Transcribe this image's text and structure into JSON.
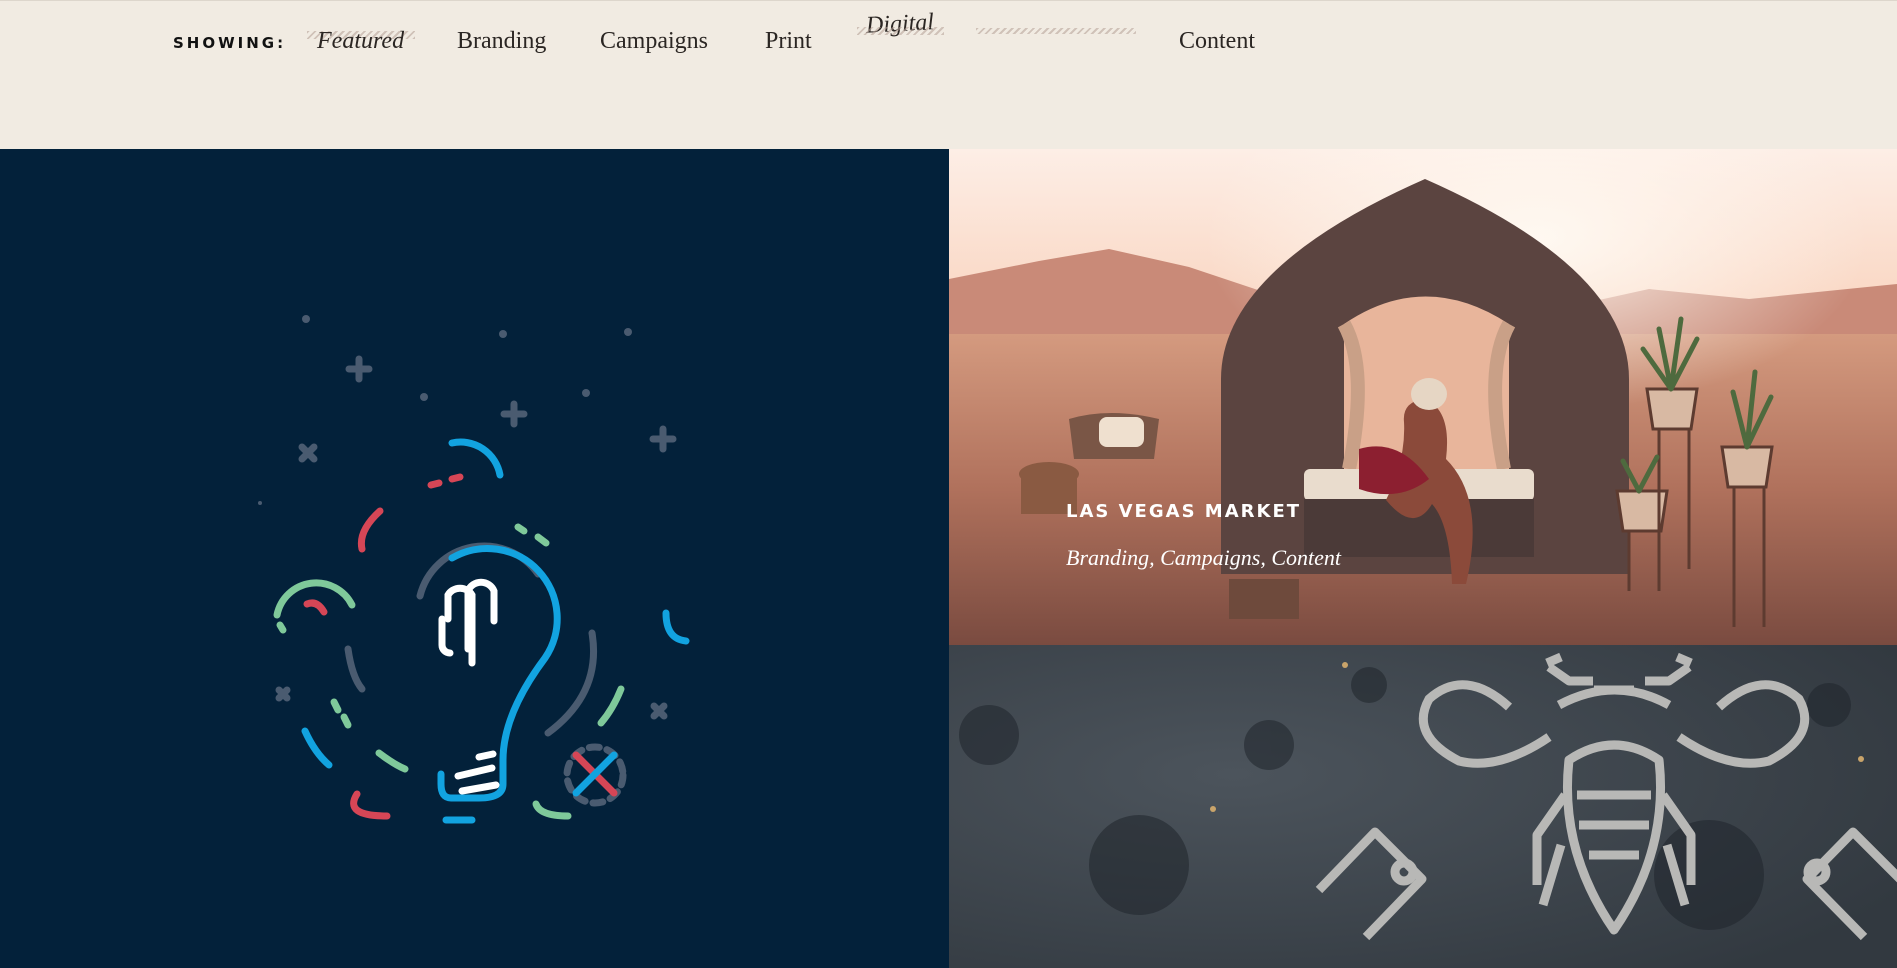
{
  "filter": {
    "label": "SHOWING:",
    "items": [
      {
        "label": "Featured",
        "active": true
      },
      {
        "label": "Branding"
      },
      {
        "label": "Campaigns"
      },
      {
        "label": "Print"
      },
      {
        "label": "Digital"
      },
      {
        "label": "Content"
      }
    ]
  },
  "projects": [
    {
      "kind": "illustration",
      "icon": "lightbulb-icon",
      "background": "#03213a"
    },
    {
      "title": "LAS VEGAS MARKET",
      "tags": "Branding, Campaigns, Content"
    },
    {
      "kind": "illustration",
      "icon": "bee-icon",
      "background": "#3f474f"
    }
  ]
}
